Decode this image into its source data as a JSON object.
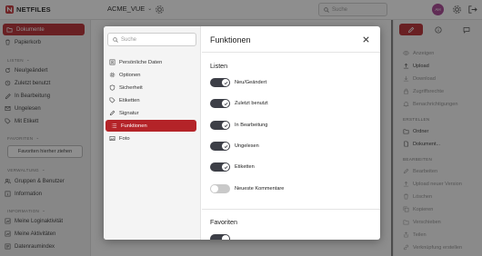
{
  "app": {
    "brand": "NETFILES",
    "workspace": "ACME_VUE",
    "search_placeholder": "Suche",
    "avatar_initials": "AH"
  },
  "sidebar": {
    "active_item": "Dokumente",
    "items_top": [
      "Papierkorb"
    ],
    "lists_heading": "LISTEN",
    "lists": [
      "Neu/geändert",
      "Zuletzt benutzt",
      "In Bearbeitung",
      "Ungelesen",
      "Mit Etikett"
    ],
    "favorites_heading": "FAVORITEN",
    "favorites_button": "Favoriten hierher ziehen",
    "admin_heading": "VERWALTUNG",
    "admin": [
      "Gruppen & Benutzer",
      "Information"
    ],
    "info_heading": "INFORMATION",
    "info": [
      "Meine Loginaktivität",
      "Meine Aktivitäten",
      "Datenraumindex"
    ]
  },
  "rightpane": {
    "items1": [
      {
        "label": "Anzeigen",
        "enabled": false
      },
      {
        "label": "Upload",
        "enabled": true
      },
      {
        "label": "Download",
        "enabled": false
      },
      {
        "label": "Zugriffsrechte",
        "enabled": false
      },
      {
        "label": "Benachrichtigungen",
        "enabled": false
      }
    ],
    "create_heading": "ERSTELLEN",
    "create": [
      "Ordner",
      "Dokument..."
    ],
    "edit_heading": "BEARBEITEN",
    "edit": [
      "Bearbeiten",
      "Upload neuer Version",
      "Löschen",
      "Kopieren",
      "Verschieben",
      "Teilen",
      "Verknüpfung erstellen"
    ]
  },
  "modal": {
    "search_placeholder": "Suche",
    "title": "Funktionen",
    "nav": [
      "Persönliche Daten",
      "Optionen",
      "Sicherheit",
      "Etiketten",
      "Signatur",
      "Funktionen",
      "Foto"
    ],
    "active_nav": "Funktionen",
    "section_lists": "Listen",
    "toggles": [
      {
        "label": "Neu/Geändert",
        "on": true
      },
      {
        "label": "Zuletzt benutzt",
        "on": true
      },
      {
        "label": "In Bearbeitung",
        "on": true
      },
      {
        "label": "Ungelesen",
        "on": true
      },
      {
        "label": "Etiketten",
        "on": true
      },
      {
        "label": "Neueste Kommentare",
        "on": false
      }
    ],
    "section_favorites": "Favoriten"
  },
  "colors": {
    "accent": "#b42328",
    "toggle_on": "#3d3f47",
    "toggle_off": "#c9c9c9"
  }
}
